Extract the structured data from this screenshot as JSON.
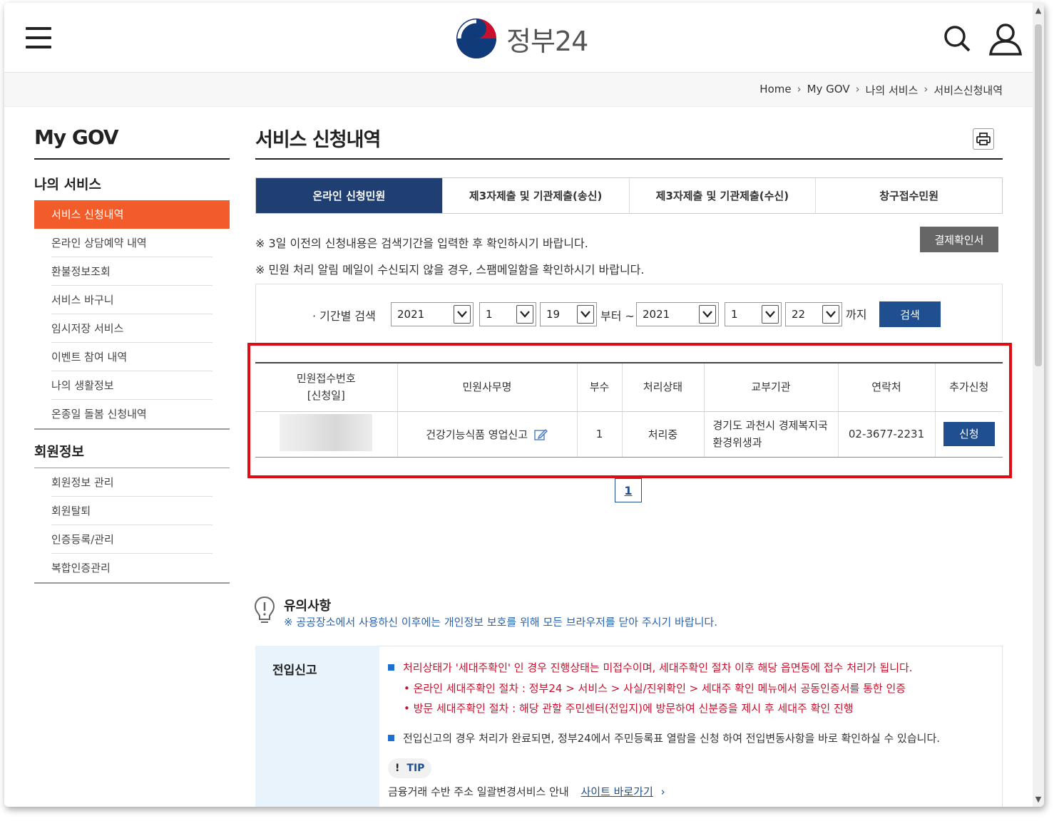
{
  "header": {
    "logo_text": "정부24"
  },
  "breadcrumb": [
    "Home",
    "My GOV",
    "나의 서비스",
    "서비스신청내역"
  ],
  "sidebar": {
    "title": "My GOV",
    "section1": "나의 서비스",
    "items1": [
      "서비스 신청내역",
      "온라인 상담예약 내역",
      "환불정보조회",
      "서비스 바구니",
      "임시저장 서비스",
      "이벤트 참여 내역",
      "나의 생활정보",
      "온종일 돌봄 신청내역"
    ],
    "section2": "회원정보",
    "items2": [
      "회원정보 관리",
      "회원탈퇴",
      "인증등록/관리",
      "복합인증관리"
    ]
  },
  "main": {
    "title": "서비스 신청내역",
    "tabs": [
      "온라인 신청민원",
      "제3자제출 및 기관제출(송신)",
      "제3자제출 및 기관제출(수신)",
      "창구접수민원"
    ],
    "notice1": "※ 3일 이전의 신청내용은 검색기간을 입력한 후 확인하시기 바랍니다.",
    "notice2": "※ 민원 처리 알림 메일이 수신되지 않을 경우, 스팸메일함을 확인하시기 바랍니다.",
    "payment_button": "결제확인서",
    "search": {
      "label": "기간별 검색",
      "from_year": "2021",
      "from_month": "1",
      "from_day": "19",
      "from_text": "부터 ~",
      "to_year": "2021",
      "to_month": "1",
      "to_day": "22",
      "to_text": "까지",
      "button": "검색"
    },
    "table": {
      "headers": [
        "민원접수번호",
        "[신청일]",
        "민원사무명",
        "부수",
        "처리상태",
        "교부기관",
        "연락처",
        "추가신청"
      ],
      "row": {
        "name": "건강기능식품 영업신고",
        "count": "1",
        "status": "처리중",
        "agency_line1": "경기도 과천시 경제복지국",
        "agency_line2": "환경위생과",
        "contact": "02-3677-2231",
        "apply_button": "신청"
      }
    },
    "page": "1"
  },
  "caution": {
    "title": "유의사항",
    "text": "※ 공공장소에서 사용하신 이후에는 개인정보 보호를 위해 모든 브라우저를 닫아 주시기 바랍니다."
  },
  "info": {
    "title": "전입신고",
    "line1": "처리상태가 '세대주확인' 인 경우 진행상태는 미접수이며, 세대주확인 절차 이후 해당 읍면동에 접수 처리가 됩니다.",
    "line2": "• 온라인 세대주확인 절차 : 정부24 > 서비스 > 사실/진위확인 > 세대주 확인 메뉴에서 공동인증서를 통한 인증",
    "line3": "• 방문 세대주확인 절차 : 해당 관할 주민센터(전입지)에 방문하여 신분증을 제시 후 세대주 확인 진행",
    "line4": "전입신고의 경우 처리가 완료되면, 정부24에서 주민등록표 열람을 신청 하여 전입변동사항을 바로 확인하실 수 있습니다.",
    "tip_mark": "!",
    "tip_label": "TIP",
    "tip_text": "금융거래 수반 주소 일괄변경서비스 안내",
    "tip_link": "사이트 바로가기"
  }
}
